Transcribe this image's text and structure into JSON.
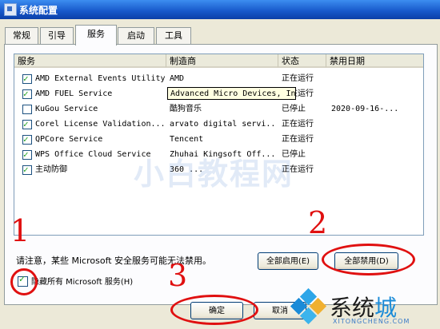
{
  "window": {
    "title": "系统配置"
  },
  "tabs": [
    {
      "label": "常规",
      "active": false
    },
    {
      "label": "引导",
      "active": false
    },
    {
      "label": "服务",
      "active": true
    },
    {
      "label": "启动",
      "active": false
    },
    {
      "label": "工具",
      "active": false
    }
  ],
  "services": {
    "columns": [
      "服务",
      "制造商",
      "状态",
      "禁用日期"
    ],
    "rows": [
      {
        "checked": true,
        "name": "AMD External Events Utility",
        "maker": "AMD",
        "status": "正在运行",
        "date": ""
      },
      {
        "checked": true,
        "name": "AMD FUEL Service",
        "maker": "",
        "status": "正在运行",
        "date": ""
      },
      {
        "checked": false,
        "name": "KuGou Service",
        "maker": "酷狗音乐",
        "status": "已停止",
        "date": "2020-09-16-..."
      },
      {
        "checked": true,
        "name": "Corel License Validation...",
        "maker": "arvato digital servi...",
        "status": "正在运行",
        "date": ""
      },
      {
        "checked": true,
        "name": "QPCore Service",
        "maker": "Tencent",
        "status": "正在运行",
        "date": ""
      },
      {
        "checked": true,
        "name": "WPS Office Cloud Service",
        "maker": "Zhuhai Kingsoft Off...",
        "status": "已停止",
        "date": ""
      },
      {
        "checked": true,
        "name": "主动防御",
        "maker": "360 ...",
        "status": "正在运行",
        "date": ""
      }
    ],
    "tooltip": "Advanced Micro Devices, Inc"
  },
  "notice": "请注意，某些 Microsoft 安全服务可能无法禁用。",
  "buttons": {
    "enable_all": "全部启用(E)",
    "disable_all": "全部禁用(D)",
    "ok": "确定",
    "cancel": "取消"
  },
  "hide_ms": {
    "checked": true,
    "label": "隐藏所有 Microsoft 服务(H)"
  },
  "annotations": {
    "n1": "1",
    "n2": "2",
    "n3": "3",
    "color": "#e01010"
  },
  "watermark": "小白教程网",
  "logo": {
    "text_prefix": "系统",
    "text_suffix": "城",
    "sub": "XITONGCHENG.COM"
  }
}
